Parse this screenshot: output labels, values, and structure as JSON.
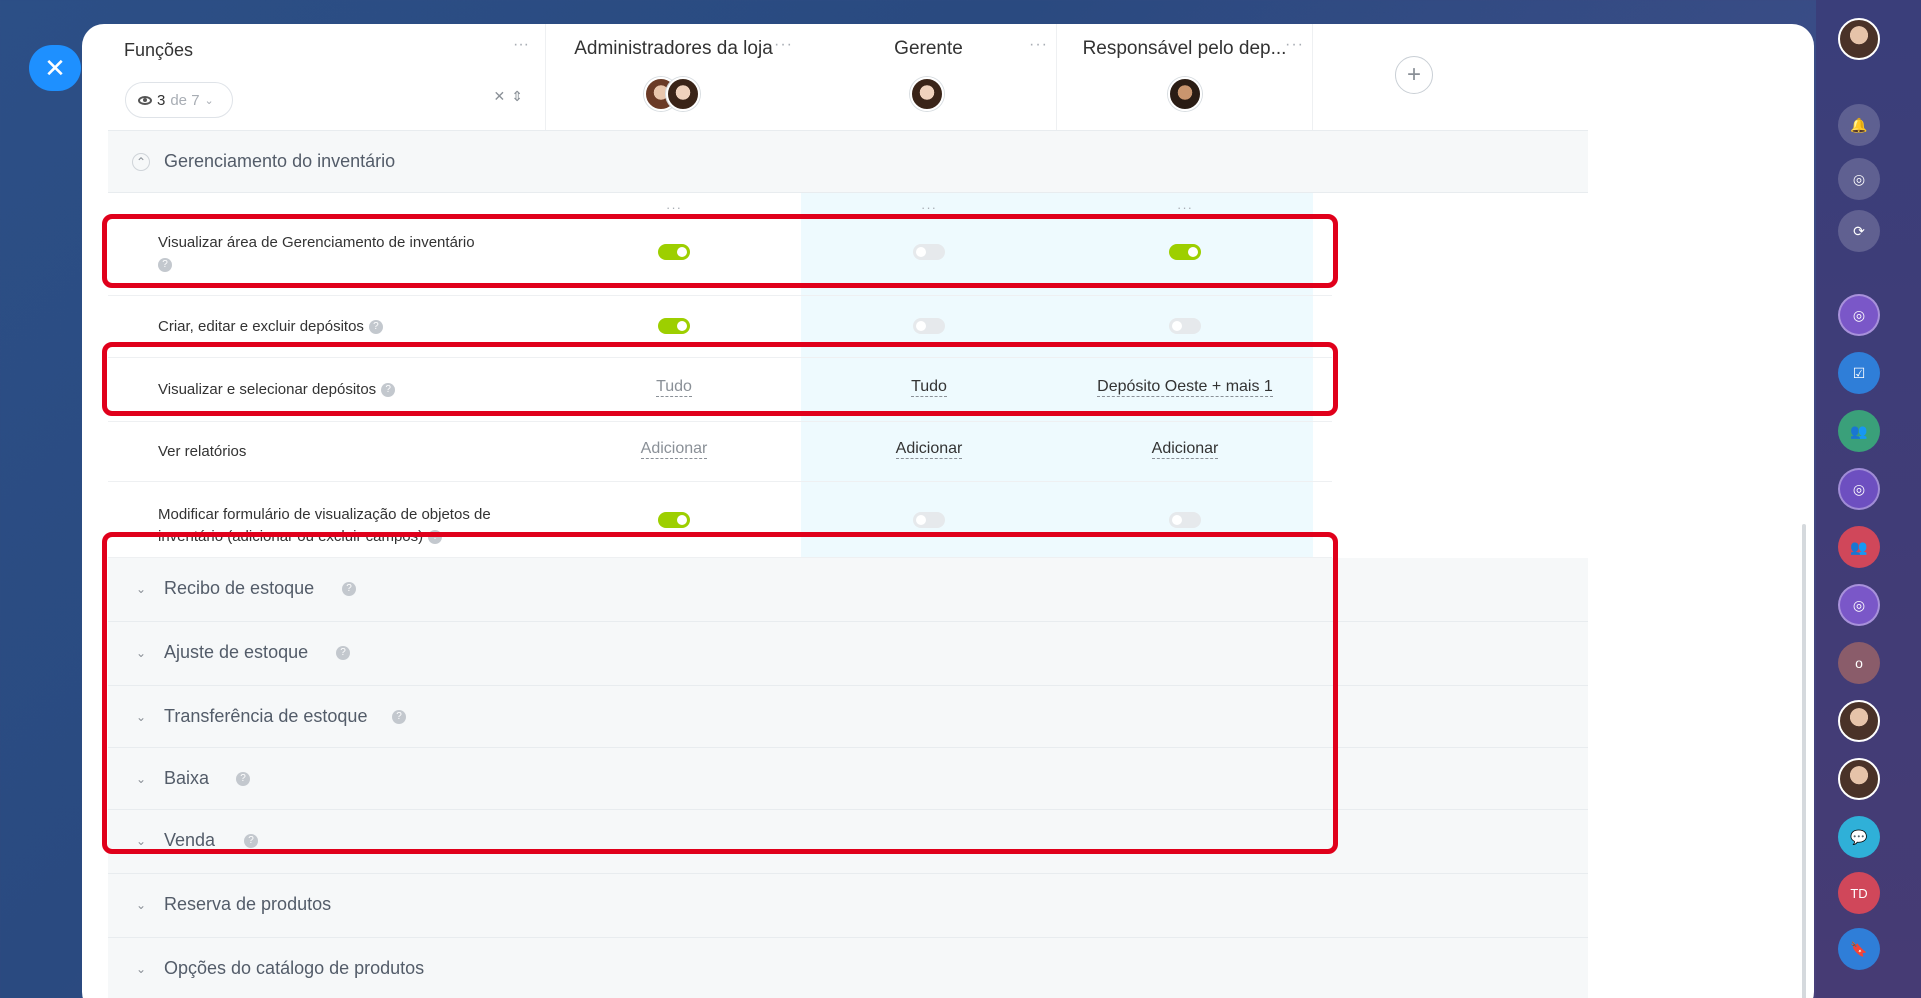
{
  "header": {
    "functions_title": "Funções",
    "view_count": "3",
    "view_of": "de 7",
    "dots": "···",
    "columns": [
      {
        "title": "Administradores da loja"
      },
      {
        "title": "Gerente"
      },
      {
        "title": "Responsável pelo dep..."
      }
    ],
    "add_label": "+"
  },
  "sections": {
    "inventory": {
      "label": "Gerenciamento do inventário"
    },
    "collapsed": [
      {
        "label": "Recibo de estoque"
      },
      {
        "label": "Ajuste de estoque"
      },
      {
        "label": "Transferência de estoque"
      },
      {
        "label": "Baixa"
      },
      {
        "label": "Venda"
      },
      {
        "label": "Reserva de produtos"
      },
      {
        "label": "Opções do catálogo de produtos"
      }
    ]
  },
  "permissions": [
    {
      "label": "Visualizar área de Gerenciamento de inventário",
      "values": [
        "on",
        "off",
        "on"
      ]
    },
    {
      "label": "Criar, editar e excluir depósitos",
      "values": [
        "on",
        "off",
        "off"
      ]
    },
    {
      "label": "Visualizar e selecionar depósitos",
      "values": [
        "Tudo",
        "Tudo",
        "Depósito Oeste + mais 1"
      ]
    },
    {
      "label": "Ver relatórios",
      "values": [
        "Adicionar",
        "Adicionar",
        "Adicionar"
      ]
    },
    {
      "label": "Modificar formulário de visualização de objetos de inventário (adicionar ou excluir campos)",
      "values": [
        "on",
        "off",
        "off"
      ]
    }
  ],
  "sidebar": {
    "avatar_initials": "TD"
  },
  "colors": {
    "toggle_on": "#9dcf00",
    "highlight": "#e0001b",
    "close_button": "#1e90ff"
  }
}
